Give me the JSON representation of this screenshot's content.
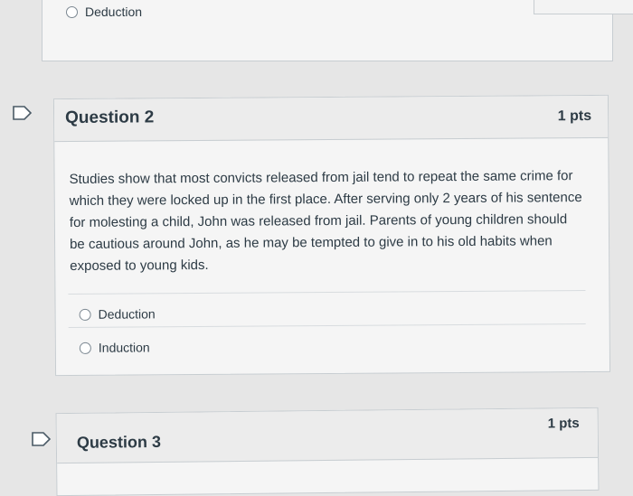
{
  "previous_question": {
    "option": "Deduction"
  },
  "question2": {
    "title": "Question 2",
    "points": "1 pts",
    "text": "Studies show that most convicts released from jail tend to repeat the same crime for which they were locked up in the first place. After serving only 2 years of his sentence for molesting a child, John was released from jail. Parents of young children should be cautious around John, as he may be tempted to give in to his old habits when exposed to young kids.",
    "options": [
      "Deduction",
      "Induction"
    ]
  },
  "question3": {
    "title": "Question 3",
    "points": "1 pts"
  }
}
